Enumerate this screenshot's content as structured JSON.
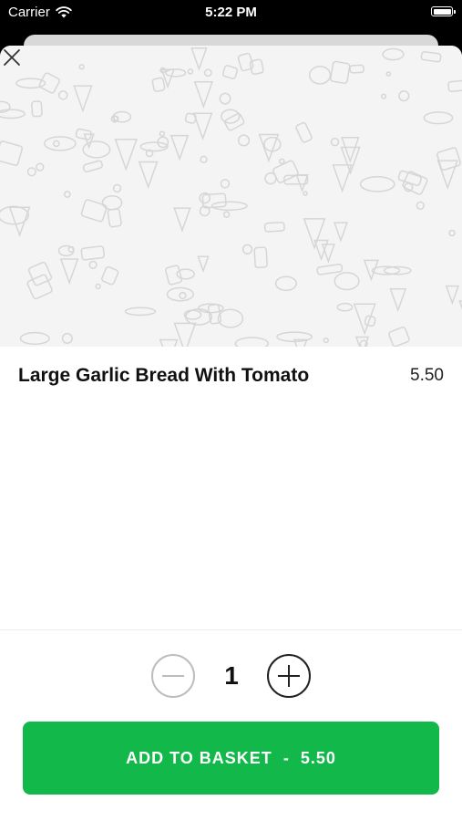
{
  "status_bar": {
    "carrier": "Carrier",
    "time": "5:22 PM"
  },
  "modal": {
    "hero_icon": "food-doodle-pattern",
    "close_icon": "close-icon"
  },
  "item": {
    "name": "Large Garlic Bread With Tomato",
    "price": "5.50"
  },
  "quantity": {
    "value": "1",
    "minus_icon": "minus-icon",
    "plus_icon": "plus-icon"
  },
  "cta": {
    "label": "ADD TO BASKET",
    "separator": "-",
    "price": "5.50"
  },
  "colors": {
    "accent": "#12b84a",
    "hero_bg": "#f4f4f4"
  }
}
